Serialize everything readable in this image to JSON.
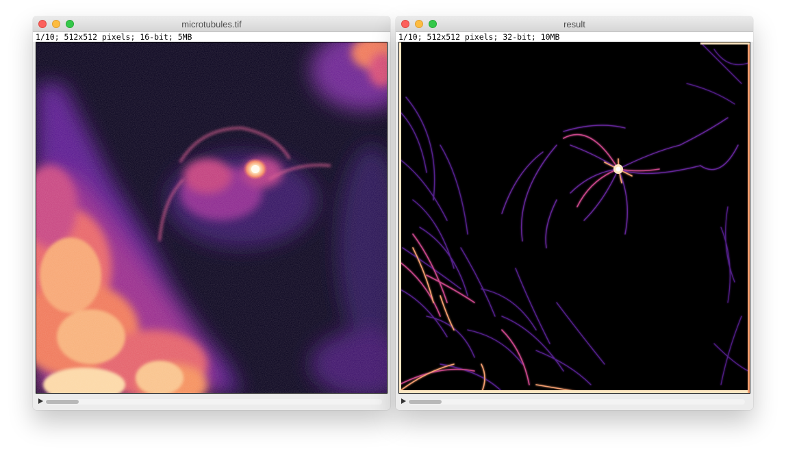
{
  "windows": [
    {
      "id": "microtubules",
      "title": "microtubules.tif",
      "info": "1/10; 512x512 pixels; 16-bit; 5MB"
    },
    {
      "id": "result",
      "title": "result",
      "info": "1/10; 512x512 pixels; 32-bit; 10MB"
    }
  ],
  "colors": {
    "lut_dark": "#0b0724",
    "lut_purple": "#6a1f9c",
    "lut_magenta": "#b7378a",
    "lut_orange": "#f47b5b",
    "lut_light": "#fde9c9",
    "close_button": "#fc605c",
    "minimize_button": "#fdbc40",
    "zoom_button": "#34c84a"
  },
  "icons": {
    "close": "close-icon",
    "minimize": "minimize-icon",
    "zoom": "zoom-icon",
    "play": "play-icon"
  }
}
